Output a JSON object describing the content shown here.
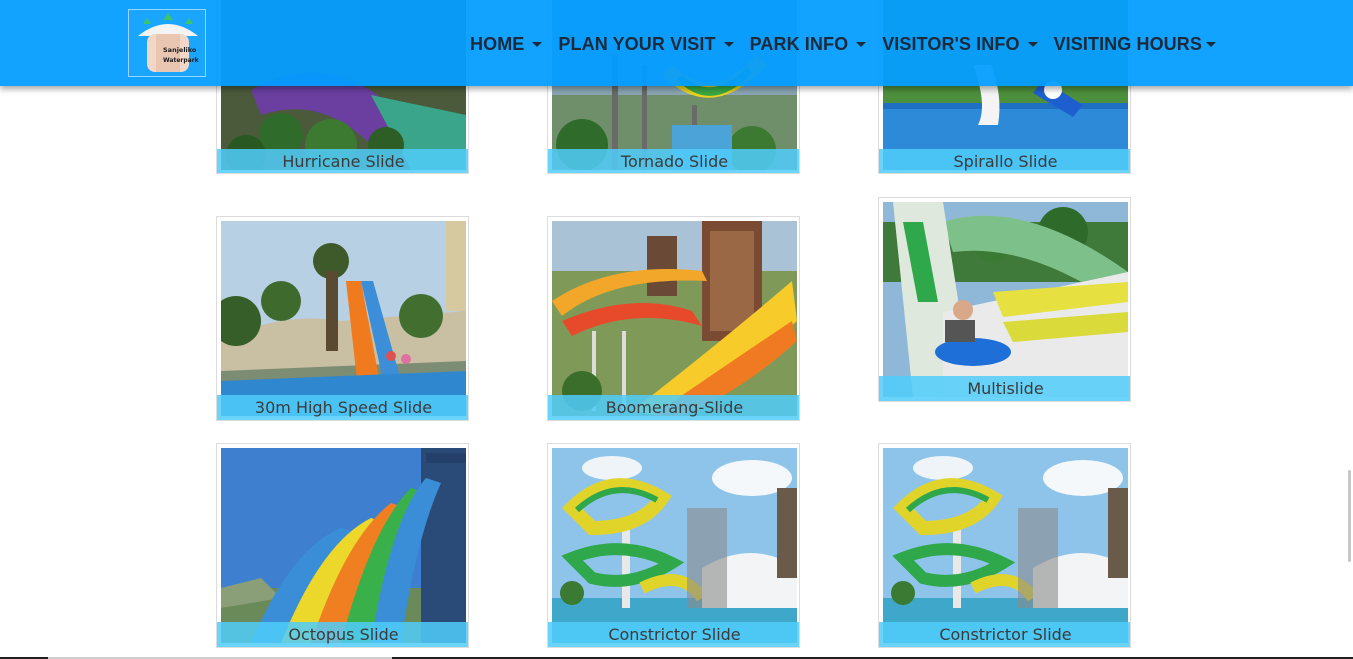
{
  "brand": {
    "logo_line1": "Sanjeliko",
    "logo_line2": "Waterpark"
  },
  "nav": [
    {
      "label": "HOME"
    },
    {
      "label": "PLAN YOUR VISIT"
    },
    {
      "label": "PARK INFO"
    },
    {
      "label": "VISITOR'S INFO"
    },
    {
      "label": "VISITING HOURS"
    }
  ],
  "gallery": {
    "row1": [
      "Hurricane Slide",
      "Tornado Slide",
      "Spirallo Slide"
    ],
    "row2": [
      "30m High Speed Slide",
      "Boomerang-Slide",
      "Multislide"
    ],
    "row3": [
      "Octopus Slide",
      "Constrictor Slide",
      "Constrictor Slide"
    ]
  },
  "colors": {
    "navbar": "#039cff",
    "caption_bg": "#50cdfa",
    "nav_text": "#1b2a3a"
  }
}
